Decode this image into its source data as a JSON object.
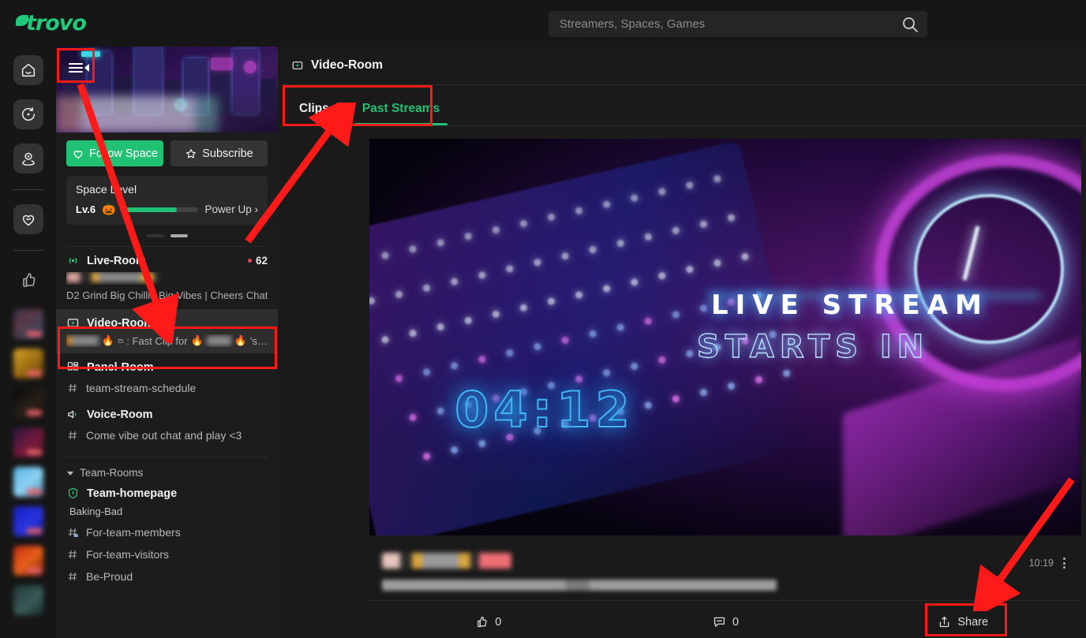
{
  "app": {
    "logo_text": "trovo"
  },
  "search": {
    "placeholder": "Streamers, Spaces, Games",
    "value": "",
    "icon": "search-icon"
  },
  "rail": {
    "items": [
      {
        "icon": "home-icon",
        "name": "home"
      },
      {
        "icon": "explore-icon",
        "name": "explore"
      },
      {
        "icon": "location-pin-icon",
        "name": "spaces"
      },
      {
        "icon": "heart-icon",
        "name": "following"
      },
      {
        "icon": "thumbs-up-icon",
        "name": "recommended"
      }
    ],
    "live_thumbs": 8,
    "live_badge_label": "LIVE"
  },
  "sidebar": {
    "menu_toggle_icon": "collapse-sidebar-icon",
    "follow_button": {
      "label": "Follow Space",
      "icon": "heart-icon"
    },
    "subscribe_button": {
      "label": "Subscribe",
      "icon": "star-icon"
    },
    "level": {
      "title": "Space Level",
      "level_label": "Lv.6",
      "emoji": "🎃",
      "progress_percent": 72,
      "power_up_label": "Power Up",
      "chevron": "chevron-right-icon"
    },
    "carousel": {
      "dots": 2,
      "active_index": 1
    },
    "rooms": [
      {
        "name": "Live-Room",
        "icon": "broadcast-icon",
        "count": "62",
        "count_dot_color": "#e0464f",
        "subtitle": "D2 Grind Big Chillin Big Vibes | Cheers Chat …",
        "subtitle_blurred_prefix": true,
        "active": false
      },
      {
        "name": "Video-Room",
        "icon": "video-icon",
        "subtitle": ": Fast Clip for",
        "subtitle_suffix": "'s…",
        "emoji": "🔥",
        "clip_icon": "clapperboard-icon",
        "active": true,
        "highlighted": true
      },
      {
        "name": "Panel-Room",
        "icon": "panel-grid-icon",
        "active": false
      }
    ],
    "channels": [
      {
        "name": "team-stream-schedule",
        "icon": "hash-icon"
      }
    ],
    "voice": {
      "name": "Voice-Room",
      "icon": "speaker-icon"
    },
    "voice_channel": {
      "name": "Come vibe out chat and play <3",
      "icon": "hash-icon"
    },
    "team_section": {
      "header": "Team-Rooms",
      "chevron": "chevron-down-icon",
      "items": [
        {
          "name": "Team-homepage",
          "icon": "shield-icon",
          "bold": true,
          "sub": "Baking-Bad"
        },
        {
          "name": "For-team-members",
          "icon": "hash-lock-icon",
          "bold": false
        },
        {
          "name": "For-team-visitors",
          "icon": "hash-icon",
          "bold": false
        },
        {
          "name": "Be-Proud",
          "icon": "hash-icon",
          "bold": false
        }
      ]
    }
  },
  "main": {
    "header": {
      "title": "Video-Room",
      "icon": "video-icon"
    },
    "tabs": [
      {
        "label": "Clips",
        "active": false
      },
      {
        "label": "Past Streams",
        "active": true
      }
    ],
    "video": {
      "overlay_line1": "LIVE STREAM",
      "overlay_line2": "STARTS IN",
      "countdown": "04:12",
      "alt": "neon gaming keyboard, headset and mouse"
    },
    "meta": {
      "timestamp": "10:19",
      "kebab_icon": "more-vertical-icon"
    },
    "actions": [
      {
        "label": "0",
        "icon": "thumbs-up-icon",
        "name": "like"
      },
      {
        "label": "0",
        "icon": "comment-icon",
        "name": "comment"
      },
      {
        "label": "Share",
        "icon": "share-icon",
        "name": "share",
        "highlighted": true
      }
    ]
  },
  "annotations": {
    "highlight_color": "#ff1a1a",
    "boxes": [
      "sidebar-collapse-toggle",
      "tabs-group",
      "video-room-item",
      "share-button"
    ],
    "arrows": [
      "toggle-to-video-room",
      "tabs-pointer",
      "share-pointer"
    ]
  },
  "colors": {
    "accent_green": "#21c173",
    "tab_active": "#21c173",
    "live_red": "#e0464f",
    "bg": "#1a1a1a"
  }
}
